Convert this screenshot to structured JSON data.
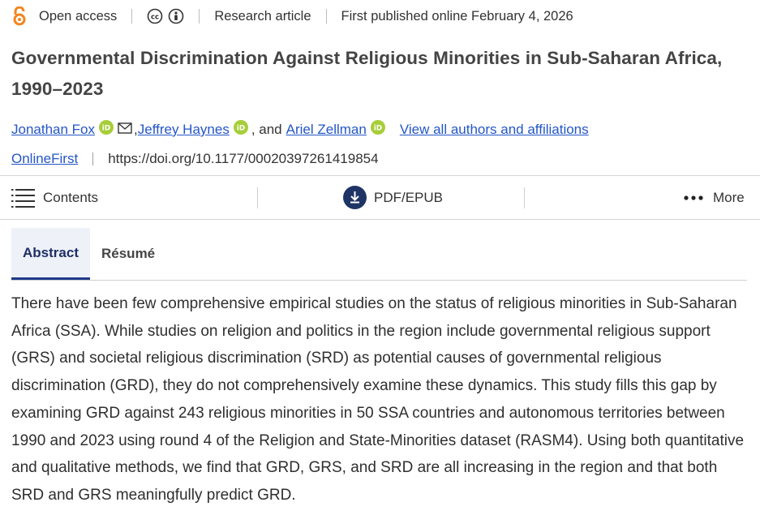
{
  "meta": {
    "access": "Open access",
    "article_type": "Research article",
    "published": "First published online February 4, 2026"
  },
  "title": "Governmental Discrimination Against Religious Minorities in Sub-Saharan Africa, 1990–2023",
  "authors": {
    "author1": "Jonathan Fox",
    "sep1": ",",
    "author2": "Jeffrey Haynes",
    "sep2": ", and",
    "author3": "Ariel Zellman",
    "view_all": "View all authors and affiliations"
  },
  "pub": {
    "status": "OnlineFirst",
    "doi": "https://doi.org/10.1177/00020397261419854"
  },
  "toolbar": {
    "contents": "Contents",
    "pdf": "PDF/EPUB",
    "more": "More"
  },
  "tabs": {
    "abstract": "Abstract",
    "resume": "Résumé"
  },
  "abstract_text": "There have been few comprehensive empirical studies on the status of religious minorities in Sub-Saharan Africa (SSA). While studies on religion and politics in the region include governmental religious support (GRS) and societal religious discrimination (SRD) as potential causes of governmental religious discrimination (GRD), they do not comprehensively examine these dynamics. This study fills this gap by examining GRD against 243 religious minorities in 50 SSA countries and autonomous territories between 1990 and 2023 using round 4 of the Religion and State-Minorities dataset (RASM4). Using both quantitative and qualitative methods, we find that GRD, GRS, and SRD are all increasing in the region and that both SRD and GRS meaningfully predict GRD.",
  "colors": {
    "link": "#2456c7",
    "oa_orange": "#f2851f",
    "orcid_green": "#a6ce39",
    "tab_active_border": "#1e3a8a",
    "pdf_icon": "#1e3466"
  },
  "icons": [
    "open-access-icon",
    "cc-icon",
    "by-icon",
    "orcid-icon",
    "mail-icon",
    "menu-icon",
    "download-icon",
    "more-dots-icon"
  ]
}
